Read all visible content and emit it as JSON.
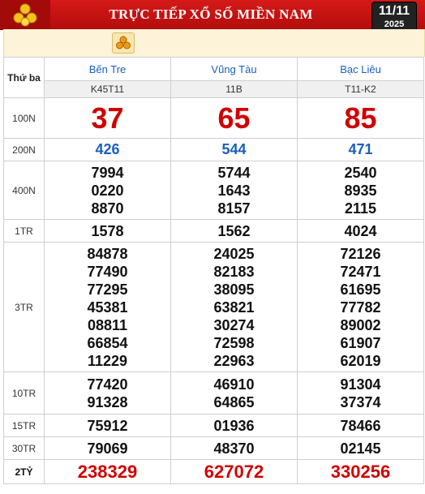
{
  "header": {
    "title": "TRỰC TIẾP XỔ SỐ MIỀN NAM",
    "date": "11/11",
    "year": "2025",
    "logo_icon": "lottery-balls-icon"
  },
  "table": {
    "day_label": "Thứ ba",
    "provinces": [
      {
        "name": "Bến Tre",
        "code": "K45T11"
      },
      {
        "name": "Vũng Tàu",
        "code": "11B"
      },
      {
        "name": "Bạc Liêu",
        "code": "T11-K2"
      }
    ],
    "prizes": {
      "p100n": {
        "label": "100N",
        "values": [
          "37",
          "65",
          "85"
        ]
      },
      "p200n": {
        "label": "200N",
        "values": [
          "426",
          "544",
          "471"
        ]
      },
      "p400n": {
        "label": "400N",
        "values": [
          [
            "7994",
            "0220",
            "8870"
          ],
          [
            "5744",
            "1643",
            "8157"
          ],
          [
            "2540",
            "8935",
            "2115"
          ]
        ]
      },
      "p1tr": {
        "label": "1TR",
        "values": [
          "1578",
          "1562",
          "4024"
        ]
      },
      "p3tr": {
        "label": "3TR",
        "values": [
          [
            "84878",
            "77490",
            "77295",
            "45381",
            "08811",
            "66854",
            "11229"
          ],
          [
            "24025",
            "82183",
            "38095",
            "63821",
            "30274",
            "72598",
            "22963"
          ],
          [
            "72126",
            "72471",
            "61695",
            "77782",
            "89002",
            "61907",
            "62019"
          ]
        ]
      },
      "p10tr": {
        "label": "10TR",
        "values": [
          [
            "77420",
            "91328"
          ],
          [
            "46910",
            "64865"
          ],
          [
            "91304",
            "37374"
          ]
        ]
      },
      "p15tr": {
        "label": "15TR",
        "values": [
          "75912",
          "01936",
          "78466"
        ]
      },
      "p30tr": {
        "label": "30TR",
        "values": [
          "79069",
          "48370",
          "02145"
        ]
      },
      "p2ty": {
        "label": "2TỶ",
        "values": [
          "238329",
          "627072",
          "330256"
        ]
      }
    }
  },
  "colors": {
    "header_red": "#c8140f",
    "province_blue": "#1b5fbf",
    "prize_red": "#d10000"
  }
}
